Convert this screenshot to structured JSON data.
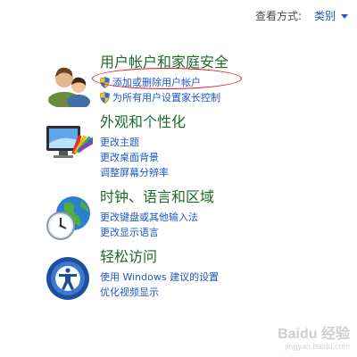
{
  "header": {
    "view_by_label": "查看方式:",
    "view_by_value": "类别"
  },
  "sections": [
    {
      "heading": "用户帐户和家庭安全",
      "links": [
        "添加或删除用户帐户",
        "为所有用户设置家长控制"
      ]
    },
    {
      "heading": "外观和个性化",
      "links": [
        "更改主题",
        "更改桌面背景",
        "调整屏幕分辨率"
      ]
    },
    {
      "heading": "时钟、语言和区域",
      "links": [
        "更改键盘或其他输入法",
        "更改显示语言"
      ]
    },
    {
      "heading": "轻松访问",
      "links": [
        "使用 Windows 建议的设置",
        "优化视频显示"
      ]
    }
  ],
  "watermark": {
    "brand": "Baidu 经验",
    "url": "jingyan.baidu.com"
  },
  "colors": {
    "heading": "#1c6a2a",
    "link": "#1f58c5",
    "annotation": "#e0161a"
  }
}
